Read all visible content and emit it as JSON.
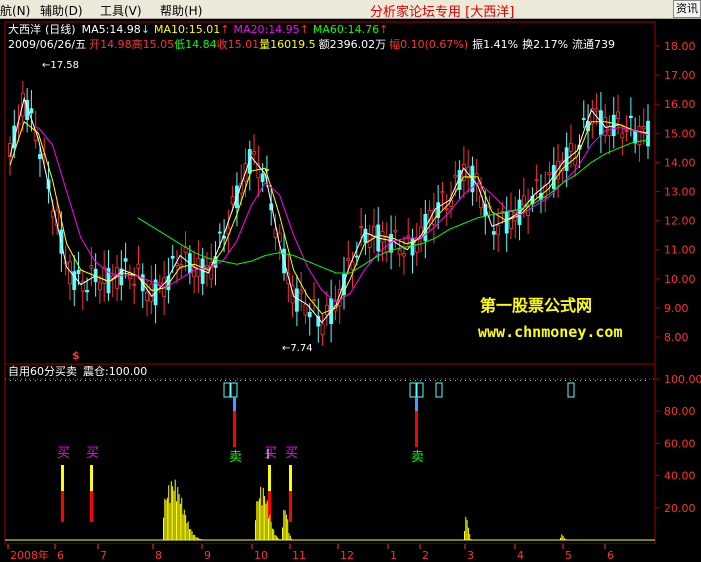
{
  "menu": {
    "items": [
      "航(N)",
      "辅助(D)",
      "工具(V)",
      "帮助(H)"
    ],
    "title": "分析家论坛专用 [大西洋]",
    "right_button": "资讯"
  },
  "header": {
    "name": "大西洋",
    "period": "(日线)",
    "ma5": "MA5:14.98",
    "ma10": "MA10:15.01",
    "ma20": "MA20:14.95",
    "ma60": "MA60:14.76",
    "date": "2009/06/26/五",
    "open": "开14.98",
    "high": "高15.05",
    "low": "低14.84",
    "close": "收15.01",
    "volume": "量16019.5",
    "amount": "额2396.02万",
    "change": "幅0.10(0.67%)",
    "amplitude": "振1.41%",
    "turnover": "换2.17%",
    "float": "流通739"
  },
  "price_axis": [
    "18.00",
    "17.00",
    "16.00",
    "15.00",
    "14.00",
    "13.00",
    "12.00",
    "11.00",
    "10.00",
    "9.00",
    "8.00"
  ],
  "annotations": {
    "high_label": "17.58",
    "low_label": "7.74",
    "marker": "$"
  },
  "watermark": {
    "line1": "第一股票公式网",
    "line2": "www.chnmoney.com"
  },
  "indicator": {
    "title": "自用60分买卖",
    "value": "震仓:100.00",
    "axis": [
      "100.00",
      "80.00",
      "60.00",
      "40.00",
      "20.00"
    ],
    "buy_label": "买",
    "sell_label": "卖"
  },
  "time_axis": [
    "2008年",
    "6",
    "7",
    "8",
    "9",
    "10",
    "11",
    "12",
    "1",
    "2",
    "3",
    "4",
    "5",
    "6"
  ],
  "colors": {
    "up": "#ff3232",
    "down": "#54ffff",
    "ma5": "#ffffff",
    "ma10": "#ffff00",
    "ma20": "#ff00ff",
    "ma60": "#00ff00",
    "buy": "#ff00ff",
    "sell": "#00ff00"
  },
  "chart_data": {
    "type": "line",
    "series": [
      {
        "name": "MA5",
        "values": [
          14.2,
          16.2,
          14.8,
          12.6,
          10.4,
          9.8,
          10.1,
          9.9,
          10.3,
          10.1,
          9.4,
          9.9,
          10.8,
          10.4,
          10.2,
          11.4,
          12.8,
          14.2,
          13.6,
          11.2,
          9.4,
          9.1,
          8.5,
          9.1,
          10.5,
          11.6,
          11.4,
          11.3,
          11.0,
          11.5,
          12.4,
          12.7,
          13.8,
          13.2,
          11.8,
          12.0,
          12.3,
          12.9,
          13.3,
          14.0,
          14.4,
          15.8,
          15.2,
          15.3,
          15.1,
          15.0
        ]
      },
      {
        "name": "MA10",
        "values": [
          13.9,
          15.4,
          15.0,
          13.4,
          11.2,
          10.3,
          10.1,
          9.9,
          10.2,
          10.1,
          9.6,
          9.7,
          10.4,
          10.5,
          10.3,
          11.0,
          12.2,
          13.7,
          13.8,
          12.2,
          10.3,
          9.4,
          8.8,
          9.0,
          10.0,
          11.2,
          11.5,
          11.4,
          11.2,
          11.4,
          12.1,
          12.6,
          13.5,
          13.5,
          12.3,
          12.0,
          12.2,
          12.7,
          13.1,
          13.8,
          14.2,
          15.4,
          15.4,
          15.3,
          15.1,
          15.0
        ]
      },
      {
        "name": "MA20",
        "values": [
          null,
          null,
          15.2,
          14.6,
          13.0,
          11.4,
          10.6,
          10.2,
          10.1,
          10.1,
          9.9,
          9.7,
          10.0,
          10.3,
          10.4,
          10.6,
          11.3,
          12.5,
          13.3,
          12.9,
          11.5,
          10.4,
          9.6,
          9.2,
          9.5,
          10.3,
          10.9,
          11.3,
          11.4,
          11.4,
          11.8,
          12.3,
          12.9,
          13.3,
          12.9,
          12.4,
          12.2,
          12.5,
          12.8,
          13.3,
          13.8,
          14.6,
          15.1,
          15.2,
          15.1,
          14.95
        ]
      },
      {
        "name": "MA60",
        "values": [
          null,
          null,
          null,
          null,
          null,
          null,
          null,
          null,
          null,
          12.1,
          11.8,
          11.5,
          11.2,
          10.9,
          10.7,
          10.6,
          10.5,
          10.6,
          10.8,
          10.9,
          10.8,
          10.6,
          10.4,
          10.2,
          10.2,
          10.5,
          10.8,
          11.0,
          11.1,
          11.2,
          11.4,
          11.7,
          11.9,
          12.1,
          12.2,
          12.3,
          12.4,
          12.6,
          12.9,
          13.3,
          13.6,
          14.0,
          14.3,
          14.5,
          14.7,
          14.76
        ]
      }
    ],
    "ylim": [
      7.6,
      18.4
    ],
    "price_high": 17.58,
    "price_low": 7.74,
    "indicator_ylim": [
      0,
      110
    ]
  }
}
